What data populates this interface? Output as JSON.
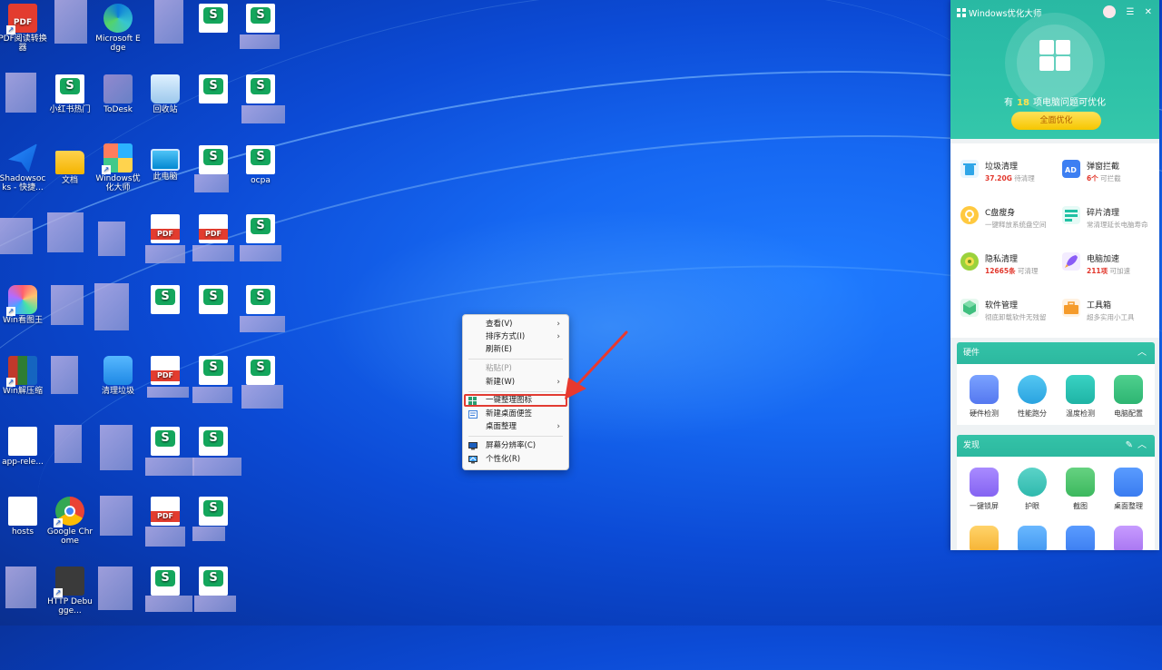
{
  "desktop": {
    "icons": [
      {
        "label": "PDF阅读转换器"
      },
      {
        "label": "Microsoft Edge"
      },
      {
        "label": "小红书热门"
      },
      {
        "label": "ToDesk"
      },
      {
        "label": "回收站"
      },
      {
        "label": "Shadowsocks - 快捷..."
      },
      {
        "label": "文档"
      },
      {
        "label": "Windows优化大师"
      },
      {
        "label": "此电脑"
      },
      {
        "label": "ocpa"
      },
      {
        "label": "Win看图王"
      },
      {
        "label": "Win解压缩"
      },
      {
        "label": "清理垃圾"
      },
      {
        "label": "app-rele..."
      },
      {
        "label": "hosts"
      },
      {
        "label": "Google Chrome"
      },
      {
        "label": "HTTP Debugge..."
      }
    ]
  },
  "context_menu": {
    "items": [
      {
        "label": "查看(V)",
        "submenu": true
      },
      {
        "label": "排序方式(I)",
        "submenu": true
      },
      {
        "label": "刷新(E)"
      },
      {
        "label": "粘贴(P)",
        "disabled": true
      },
      {
        "label": "新建(W)",
        "submenu": true
      },
      {
        "label": "一键整理图标",
        "highlighted": true
      },
      {
        "label": "新建桌面便签"
      },
      {
        "label": "桌面整理",
        "submenu": true
      },
      {
        "label": "屏幕分辨率(C)"
      },
      {
        "label": "个性化(R)"
      }
    ]
  },
  "optimizer": {
    "title": "Windows优化大师",
    "status_prefix": "有",
    "issue_count": "18",
    "status_suffix": "项电脑问题可优化",
    "main_button": "全面优化",
    "features": [
      {
        "name": "垃圾清理",
        "value": "37.20G",
        "desc": "待清理"
      },
      {
        "name": "弹窗拦截",
        "value": "6个",
        "desc": "可拦截"
      },
      {
        "name": "C盘瘦身",
        "desc": "一键释放系统盘空间"
      },
      {
        "name": "碎片清理",
        "desc": "常清理延长电脑寿命"
      },
      {
        "name": "隐私清理",
        "value": "12665条",
        "desc": "可清理"
      },
      {
        "name": "电脑加速",
        "value": "211项",
        "desc": "可加速"
      },
      {
        "name": "软件管理",
        "desc": "彻底卸载软件无残留"
      },
      {
        "name": "工具箱",
        "desc": "超多实用小工具"
      }
    ],
    "hardware": {
      "title": "硬件",
      "tools": [
        "硬件检测",
        "性能跑分",
        "温度检测",
        "电脑配置"
      ]
    },
    "discover": {
      "title": "发现",
      "tools": [
        "一键锁屏",
        "护眼",
        "截图",
        "桌面整理"
      ]
    }
  },
  "colors": {
    "accent": "#2cb89f",
    "highlight_border": "#e23b32",
    "count_yellow": "#ffe34d",
    "value_red": "#e2372c"
  }
}
